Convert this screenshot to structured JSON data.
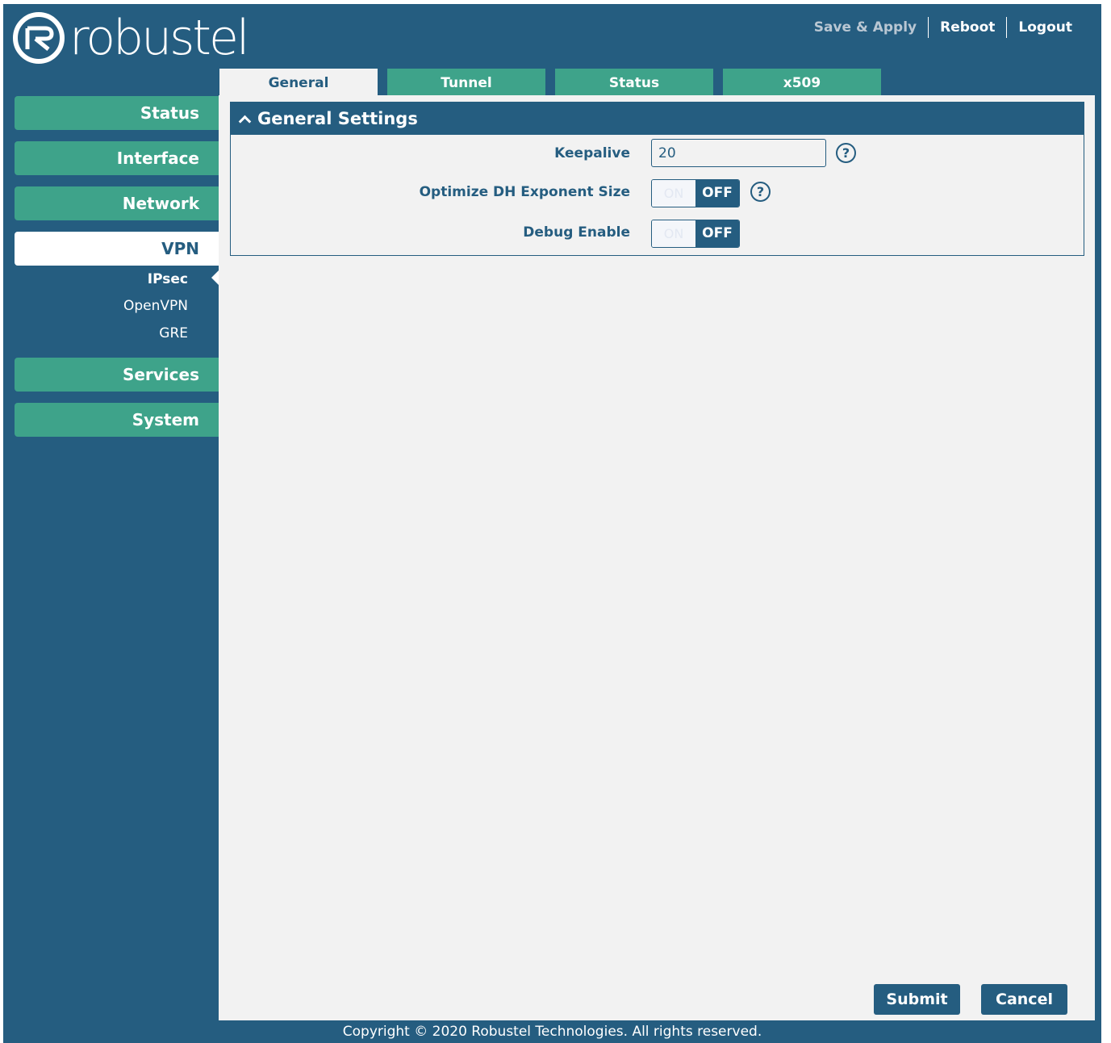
{
  "brand": {
    "name": "robustel",
    "logo_icon": "robustel-logo-icon"
  },
  "header": {
    "links": [
      "Save & Apply",
      "Reboot",
      "Logout"
    ]
  },
  "sidebar": {
    "items": [
      {
        "label": "Status"
      },
      {
        "label": "Interface"
      },
      {
        "label": "Network"
      },
      {
        "label": "VPN",
        "active": true,
        "sub_items": [
          {
            "label": "IPsec",
            "active": true
          },
          {
            "label": "OpenVPN"
          },
          {
            "label": "GRE"
          }
        ]
      },
      {
        "label": "Services"
      },
      {
        "label": "System"
      }
    ]
  },
  "tabs": [
    {
      "label": "General",
      "active": true
    },
    {
      "label": "Tunnel"
    },
    {
      "label": "Status"
    },
    {
      "label": "x509"
    }
  ],
  "panel": {
    "title": "General Settings",
    "fields": {
      "keepalive": {
        "label": "Keepalive",
        "value": "20"
      },
      "optimize_dh": {
        "label": "Optimize DH Exponent Size",
        "on_label": "ON",
        "off_label": "OFF",
        "state": "OFF"
      },
      "debug": {
        "label": "Debug Enable",
        "on_label": "ON",
        "off_label": "OFF",
        "state": "OFF"
      }
    },
    "help_glyph": "?"
  },
  "actions": {
    "submit": "Submit",
    "cancel": "Cancel"
  },
  "footer": {
    "copyright": "Copyright © 2020 Robustel Technologies. All rights reserved."
  },
  "colors": {
    "primary": "#255d80",
    "accent": "#3ea38a",
    "content_bg": "#f2f2f2",
    "muted_link": "#b9c7d3"
  }
}
